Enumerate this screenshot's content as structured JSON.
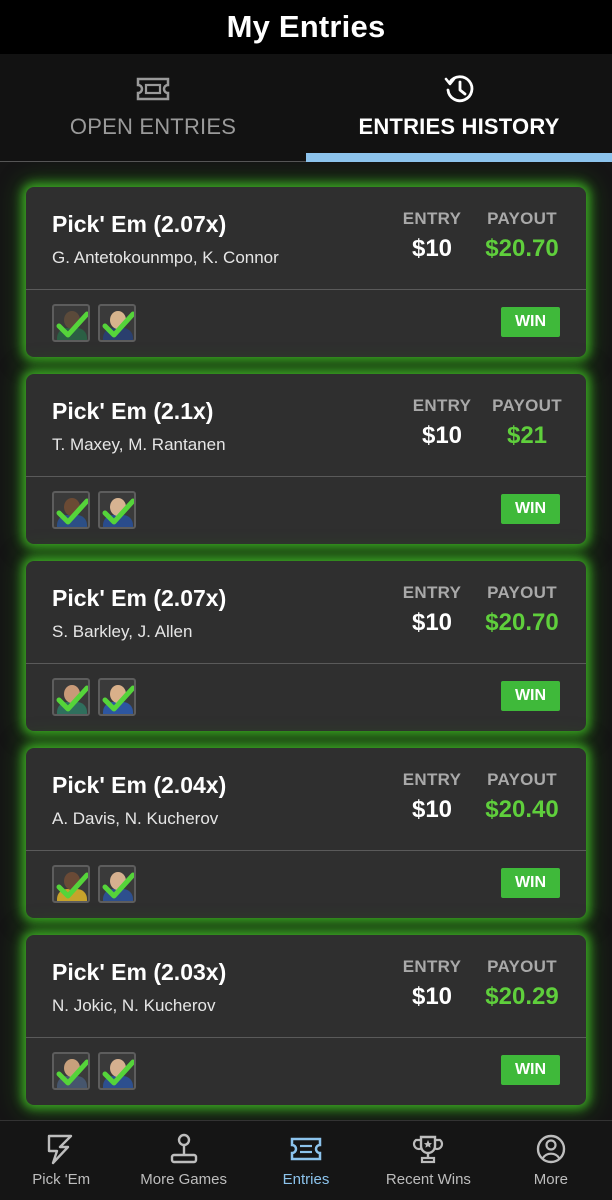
{
  "header": {
    "title": "My Entries"
  },
  "tabs": [
    {
      "label": "OPEN ENTRIES",
      "icon": "ticket-icon",
      "active": false
    },
    {
      "label": "ENTRIES HISTORY",
      "icon": "history-icon",
      "active": true
    }
  ],
  "labels": {
    "entry": "ENTRY",
    "payout": "PAYOUT"
  },
  "entries": [
    {
      "title": "Pick' Em (2.07x)",
      "players": "G. Antetokounmpo, K. Connor",
      "entry": "$10",
      "payout": "$20.70",
      "result": "WIN"
    },
    {
      "title": "Pick' Em (2.1x)",
      "players": "T. Maxey, M. Rantanen",
      "entry": "$10",
      "payout": "$21",
      "result": "WIN"
    },
    {
      "title": "Pick' Em (2.07x)",
      "players": "S. Barkley, J. Allen",
      "entry": "$10",
      "payout": "$20.70",
      "result": "WIN"
    },
    {
      "title": "Pick' Em (2.04x)",
      "players": "A. Davis, N. Kucherov",
      "entry": "$10",
      "payout": "$20.40",
      "result": "WIN"
    },
    {
      "title": "Pick' Em (2.03x)",
      "players": "N. Jokic, N. Kucherov",
      "entry": "$10",
      "payout": "$20.29",
      "result": "WIN"
    }
  ],
  "bottom_nav": [
    {
      "label": "Pick 'Em",
      "icon": "lightning-icon",
      "active": false
    },
    {
      "label": "More Games",
      "icon": "joystick-icon",
      "active": false
    },
    {
      "label": "Entries",
      "icon": "ticket-icon",
      "active": true
    },
    {
      "label": "Recent Wins",
      "icon": "trophy-icon",
      "active": false
    },
    {
      "label": "More",
      "icon": "user-icon",
      "active": false
    }
  ],
  "colors": {
    "accent_blue": "#8cc3ec",
    "win_green": "#3fb93a",
    "payout_green": "#5fcf3c",
    "glow_green": "#46c828"
  }
}
